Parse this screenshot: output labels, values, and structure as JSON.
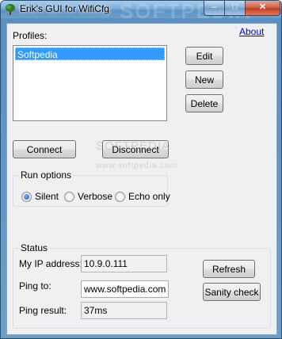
{
  "window": {
    "title": "Erik's GUI for WifiCfg",
    "watermark_title": "SOFTPEDIA",
    "controls": {
      "minimize": "–",
      "maximize": "□",
      "close": "✕"
    }
  },
  "icons": {
    "app": "tree-icon"
  },
  "about_link": "About",
  "profiles": {
    "label": "Profiles:",
    "items": [
      "Softpedia"
    ],
    "selected_index": 0,
    "edit_label": "Edit",
    "new_label": "New",
    "delete_label": "Delete"
  },
  "actions": {
    "connect_label": "Connect",
    "disconnect_label": "Disconnect"
  },
  "watermark": {
    "main": "SOFTPEDIA",
    "url": "www.softpedia.com"
  },
  "run_options": {
    "label": "Run options",
    "options": [
      "Silent",
      "Verbose",
      "Echo only"
    ],
    "selected": "Silent"
  },
  "status": {
    "label": "Status",
    "ip_label": "My IP address:",
    "ip_value": "10.9.0.111",
    "ping_label": "Ping to:",
    "ping_value": "www.softpedia.com",
    "ping_result_label": "Ping result:",
    "ping_result_value": "37ms",
    "refresh_label": "Refresh",
    "sanity_label": "Sanity check"
  }
}
